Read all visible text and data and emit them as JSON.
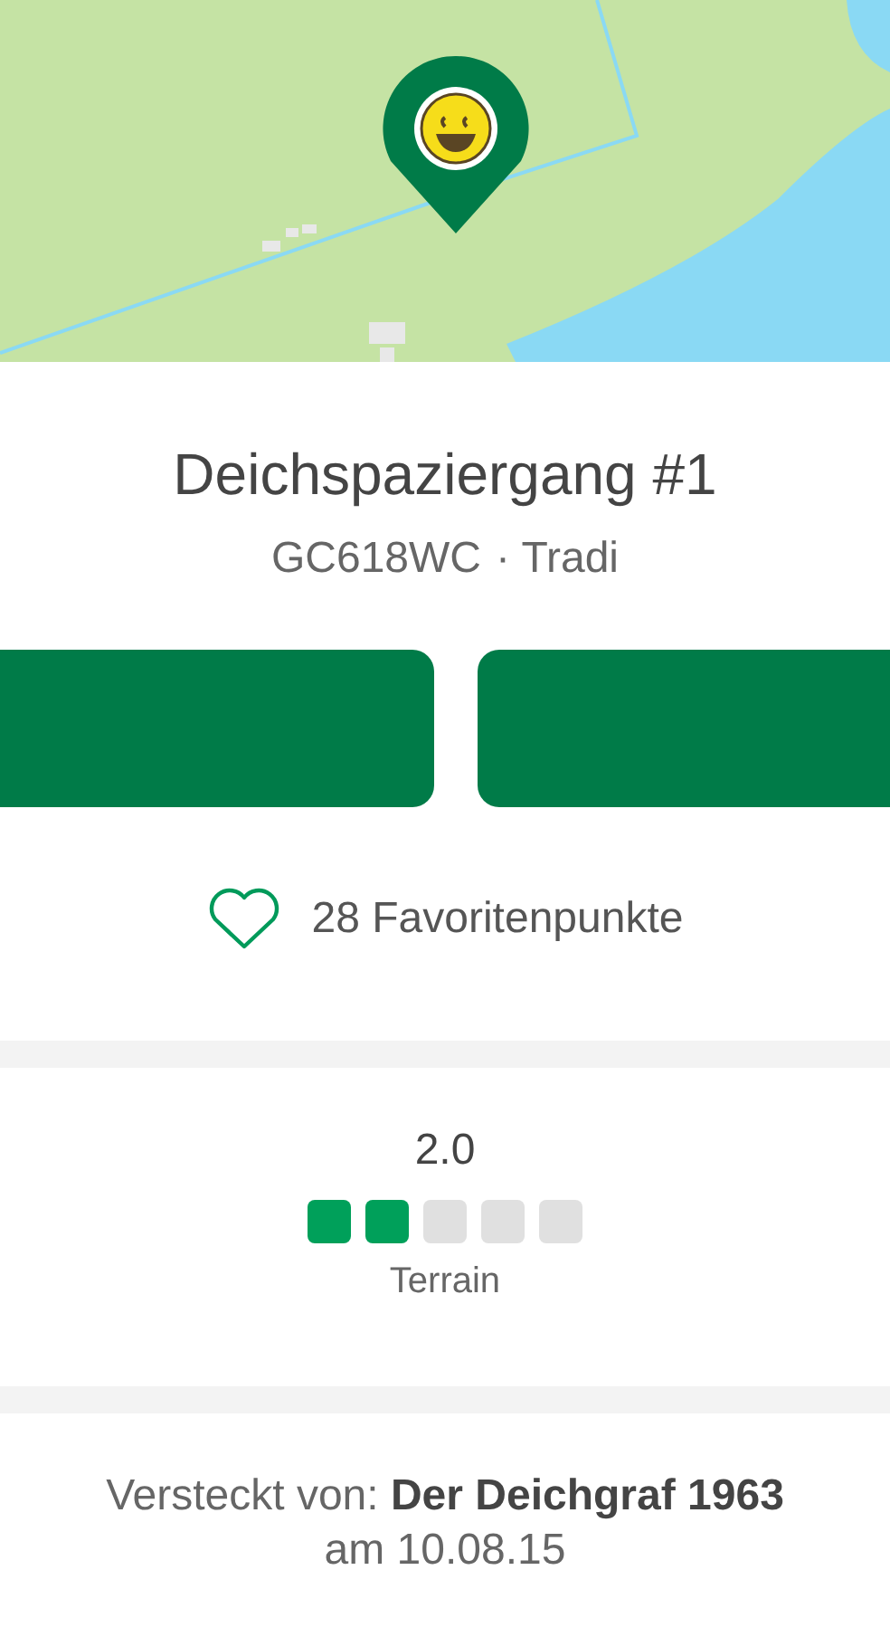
{
  "cache": {
    "name": "Deichspaziergang #1",
    "code": "GC618WC",
    "type": "· Tradi"
  },
  "action_buttons": [
    {
      "kind": "primary"
    },
    {
      "kind": "primary"
    }
  ],
  "favorites": {
    "label": "28 Favoritenpunkte"
  },
  "rating": {
    "value": "2.0",
    "stars": 2,
    "label": "Terrain"
  },
  "hidden_by": {
    "text": "Versteckt von: **Der Deichgraf 1963**",
    "date": "am 10.08.15"
  }
}
